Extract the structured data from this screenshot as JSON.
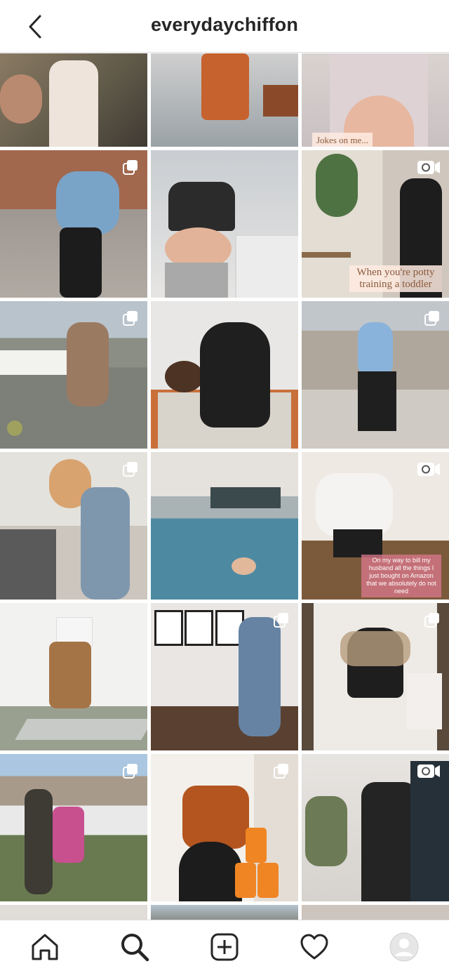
{
  "header": {
    "username": "everydaychiffon",
    "back_icon": "chevron-left-icon"
  },
  "posts": [
    {
      "type": "photo"
    },
    {
      "type": "photo"
    },
    {
      "type": "photo",
      "caption": "Jokes on me..."
    },
    {
      "type": "carousel"
    },
    {
      "type": "photo"
    },
    {
      "type": "video",
      "caption": "When you're potty training a toddler"
    },
    {
      "type": "carousel"
    },
    {
      "type": "photo"
    },
    {
      "type": "carousel"
    },
    {
      "type": "carousel"
    },
    {
      "type": "photo"
    },
    {
      "type": "video",
      "caption": "On my way to bill my husband all the things I just bought on Amazon that we absolutely do not need"
    },
    {
      "type": "photo"
    },
    {
      "type": "carousel"
    },
    {
      "type": "carousel"
    },
    {
      "type": "carousel"
    },
    {
      "type": "photo"
    },
    {
      "type": "video"
    }
  ],
  "bottom_nav": {
    "items": [
      "home-icon",
      "search-icon",
      "new-post-icon",
      "activity-heart-icon",
      "profile-avatar"
    ],
    "active": "search-icon"
  },
  "colors": {
    "text": "#262626",
    "border": "#dbdbdb",
    "background": "#ffffff"
  }
}
